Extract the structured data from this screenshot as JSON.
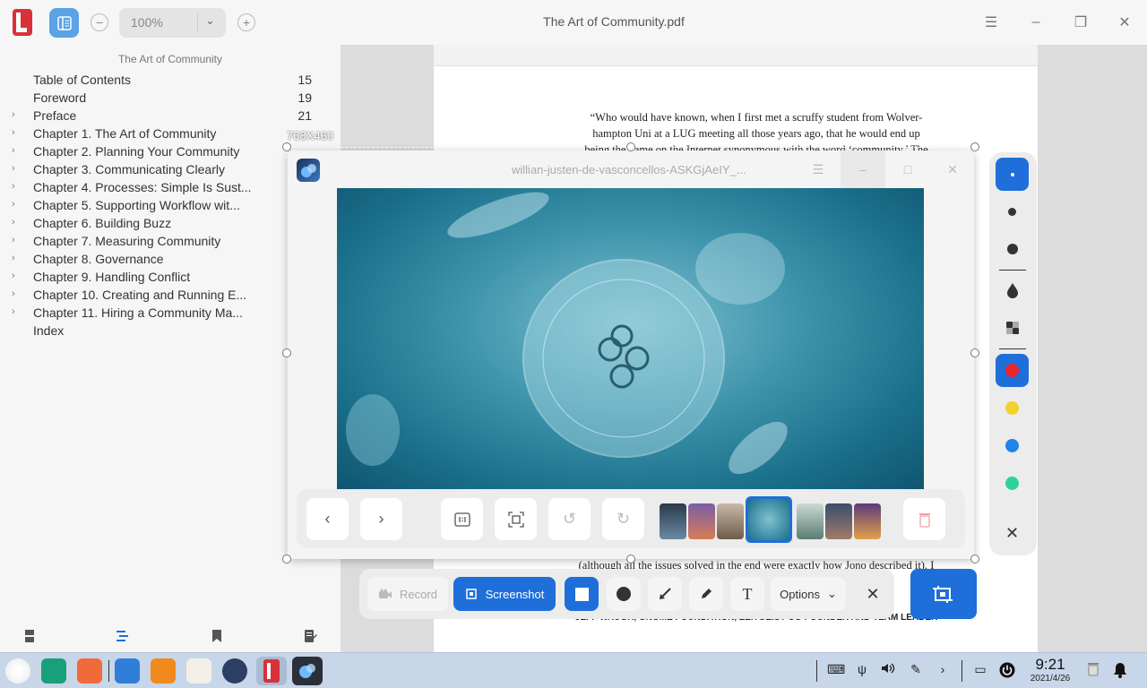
{
  "window": {
    "title": "The Art of Community.pdf",
    "zoom": "100%"
  },
  "sidebar": {
    "doc_name": "The Art of Community",
    "toc": [
      {
        "title": "Table of Contents",
        "page": "15",
        "expandable": false
      },
      {
        "title": "Foreword",
        "page": "19",
        "expandable": false
      },
      {
        "title": "Preface",
        "page": "21",
        "expandable": true
      },
      {
        "title": "Chapter 1. The Art of Community",
        "page": "",
        "expandable": true
      },
      {
        "title": "Chapter 2. Planning Your Community",
        "page": "",
        "expandable": true
      },
      {
        "title": "Chapter 3. Communicating Clearly",
        "page": "",
        "expandable": true
      },
      {
        "title": "Chapter 4. Processes: Simple Is Sust...",
        "page": "",
        "expandable": true
      },
      {
        "title": "Chapter 5. Supporting Workflow wit...",
        "page": "",
        "expandable": true
      },
      {
        "title": "Chapter 6. Building Buzz",
        "page": "",
        "expandable": true
      },
      {
        "title": "Chapter 7. Measuring Community",
        "page": "",
        "expandable": true
      },
      {
        "title": "Chapter 8. Governance",
        "page": "",
        "expandable": true
      },
      {
        "title": "Chapter 9. Handling Conflict",
        "page": "",
        "expandable": true
      },
      {
        "title": "Chapter 10. Creating and Running E...",
        "page": "",
        "expandable": true
      },
      {
        "title": "Chapter 11. Hiring a Community Ma...",
        "page": "",
        "expandable": true
      },
      {
        "title": "Index",
        "page": "",
        "expandable": false
      }
    ]
  },
  "document": {
    "quote_lines": [
      "“Who would have known, when I first met a scruffy student from Wolver-",
      "hampton Uni at a LUG meeting all those years ago, that he would end up",
      "being the name on the Internet synonymous with the word ‘community.’ The"
    ],
    "quote_bottom": "(although all the issues solved in the end were exactly how Jono described it). I",
    "quote_bottom_tail": "involve",
    "signature": "JEFF WAUGH, GNOME FOUNDATION, ZEITGEIST CO-FOUNDER AND TEAM LEADER"
  },
  "selection": {
    "size_label": "768X460"
  },
  "viewer": {
    "title": "willian-justen-de-vasconcellos-ASKGjAeIY_..."
  },
  "capture_toolbar": {
    "record_label": "Record",
    "screenshot_label": "Screenshot",
    "options_label": "Options"
  },
  "palette": {
    "colors": [
      "#e8252b",
      "#f2d22c",
      "#1e84e6",
      "#2dd39e"
    ]
  },
  "clock": {
    "time": "9:21",
    "date": "2021/4/26"
  },
  "accent_color": "#1e6fd9"
}
